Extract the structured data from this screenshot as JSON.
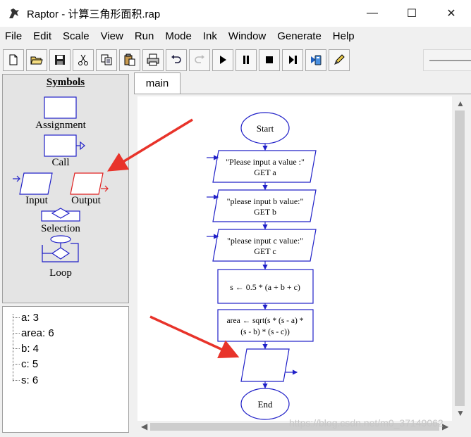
{
  "window": {
    "title": "Raptor - 计算三角形面积.rap",
    "minimize_glyph": "—",
    "maximize_glyph": "☐",
    "close_glyph": "✕"
  },
  "menu": [
    "File",
    "Edit",
    "Scale",
    "View",
    "Run",
    "Mode",
    "Ink",
    "Window",
    "Generate",
    "Help"
  ],
  "toolbar": {
    "buttons": [
      "new-file-icon",
      "open-folder-icon",
      "save-icon",
      "cut-icon",
      "copy-icon",
      "paste-icon",
      "print-icon",
      "undo-icon",
      "redo-icon",
      "run-icon",
      "pause-icon",
      "stop-icon",
      "step-icon",
      "test-server-icon",
      "pen-icon"
    ]
  },
  "symbols": {
    "title": "Symbols",
    "assignment": "Assignment",
    "call": "Call",
    "input": "Input",
    "output": "Output",
    "selection": "Selection",
    "loop": "Loop"
  },
  "variables": [
    {
      "text": "a: 3"
    },
    {
      "text": "area: 6"
    },
    {
      "text": "b: 4"
    },
    {
      "text": "c: 5"
    },
    {
      "text": "s: 6"
    }
  ],
  "tab": {
    "label": "main"
  },
  "flowchart": {
    "start": "Start",
    "input_a_line1": "\"Please input a value :\"",
    "input_a_line2": "GET a",
    "input_b_line1": "\"please input b value:\"",
    "input_b_line2": "GET b",
    "input_c_line1": "\"please input c value:\"",
    "input_c_line2": "GET c",
    "assign_s": "s ← 0.5 * (a + b + c)",
    "assign_area_line1": "area ← sqrt(s * (s - a) *",
    "assign_area_line2": "(s - b) * (s - c))",
    "end": "End"
  },
  "colors": {
    "shape_blue": "#2020c8",
    "highlight_red": "#e02020",
    "annotation_red": "#e8332a"
  },
  "watermark": "https://blog.csdn.net/m0_37149062"
}
